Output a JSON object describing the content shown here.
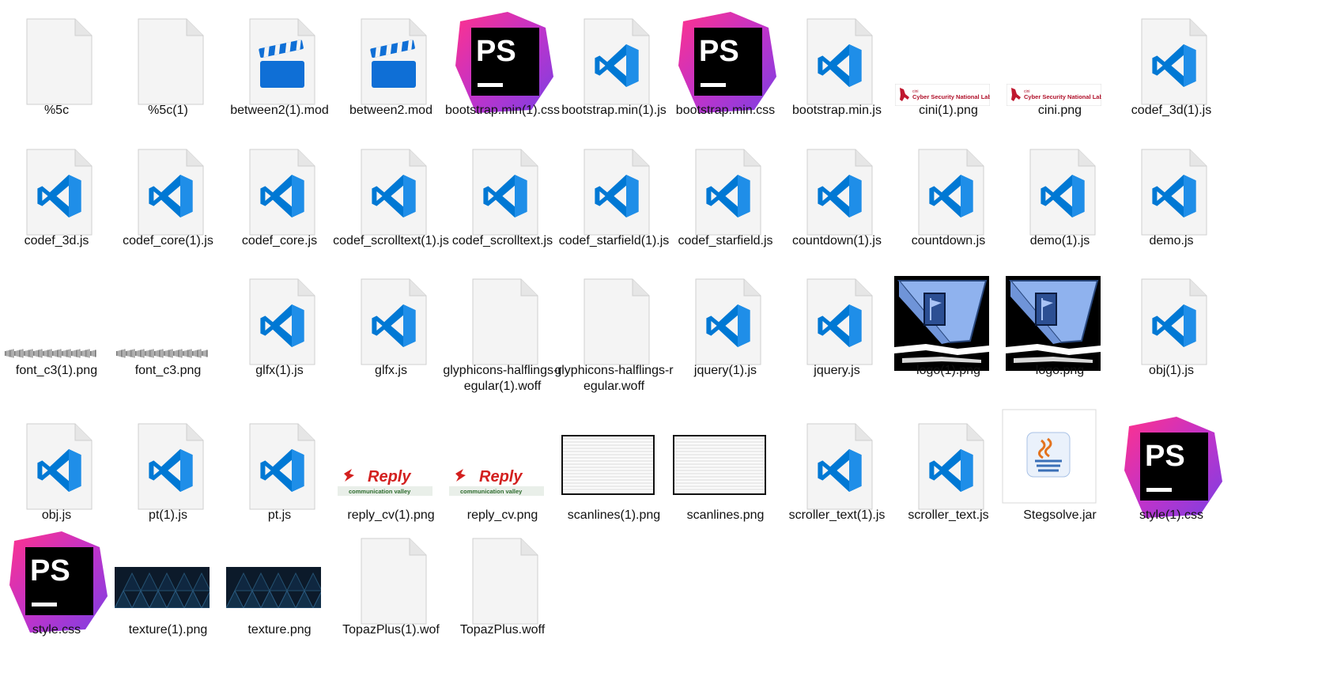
{
  "colors": {
    "vscode_blue": "#0078d4",
    "clapper_blue": "#0f6fd6",
    "ps_magenta": "#c233c9",
    "ps_purple": "#7b3fe3",
    "ps_pink": "#ff318c"
  },
  "files": [
    {
      "name": "%5c",
      "type": "blank"
    },
    {
      "name": "%5c(1)",
      "type": "blank"
    },
    {
      "name": "between2(1).mod",
      "type": "video"
    },
    {
      "name": "between2.mod",
      "type": "video"
    },
    {
      "name": "bootstrap.min(1).css",
      "type": "phpstorm"
    },
    {
      "name": "bootstrap.min(1).js",
      "type": "vscode"
    },
    {
      "name": "bootstrap.min.css",
      "type": "phpstorm"
    },
    {
      "name": "bootstrap.min.js",
      "type": "vscode"
    },
    {
      "name": "cini(1).png",
      "type": "cini"
    },
    {
      "name": "cini.png",
      "type": "cini"
    },
    {
      "name": "codef_3d(1).js",
      "type": "vscode"
    },
    {
      "name": "codef_3d.js",
      "type": "vscode"
    },
    {
      "name": "codef_core(1).js",
      "type": "vscode"
    },
    {
      "name": "codef_core.js",
      "type": "vscode"
    },
    {
      "name": "codef_scrolltext(1).js",
      "type": "vscode"
    },
    {
      "name": "codef_scrolltext.js",
      "type": "vscode"
    },
    {
      "name": "codef_starfield(1).js",
      "type": "vscode"
    },
    {
      "name": "codef_starfield.js",
      "type": "vscode"
    },
    {
      "name": "countdown(1).js",
      "type": "vscode"
    },
    {
      "name": "countdown.js",
      "type": "vscode"
    },
    {
      "name": "demo(1).js",
      "type": "vscode"
    },
    {
      "name": "demo.js",
      "type": "vscode"
    },
    {
      "name": "font_c3(1).png",
      "type": "banner"
    },
    {
      "name": "font_c3.png",
      "type": "banner"
    },
    {
      "name": "glfx(1).js",
      "type": "vscode"
    },
    {
      "name": "glfx.js",
      "type": "vscode"
    },
    {
      "name": "glyphicons-halflings-regular(1).woff",
      "type": "blank"
    },
    {
      "name": "glyphicons-halflings-regular.woff",
      "type": "blank"
    },
    {
      "name": "jquery(1).js",
      "type": "vscode"
    },
    {
      "name": "jquery.js",
      "type": "vscode"
    },
    {
      "name": "logo(1).png",
      "type": "logo"
    },
    {
      "name": "logo.png",
      "type": "logo"
    },
    {
      "name": "obj(1).js",
      "type": "vscode"
    },
    {
      "name": "obj.js",
      "type": "vscode"
    },
    {
      "name": "pt(1).js",
      "type": "vscode"
    },
    {
      "name": "pt.js",
      "type": "vscode"
    },
    {
      "name": "reply_cv(1).png",
      "type": "reply"
    },
    {
      "name": "reply_cv.png",
      "type": "reply"
    },
    {
      "name": "scanlines(1).png",
      "type": "scanlines"
    },
    {
      "name": "scanlines.png",
      "type": "scanlines"
    },
    {
      "name": "scroller_text(1).js",
      "type": "vscode"
    },
    {
      "name": "scroller_text.js",
      "type": "vscode"
    },
    {
      "name": "Stegsolve.jar",
      "type": "java"
    },
    {
      "name": "style(1).css",
      "type": "phpstorm"
    },
    {
      "name": "style.css",
      "type": "phpstorm"
    },
    {
      "name": "texture(1).png",
      "type": "texture"
    },
    {
      "name": "texture.png",
      "type": "texture"
    },
    {
      "name": "TopazPlus(1).wof",
      "type": "blank"
    },
    {
      "name": "TopazPlus.woff",
      "type": "blank"
    }
  ],
  "thumb_text": {
    "cini_small": "cini",
    "cini_label": "Cyber Security National Lab",
    "reply_brand": "Reply",
    "reply_sub": "communication valley",
    "ps_letters": "PS"
  }
}
